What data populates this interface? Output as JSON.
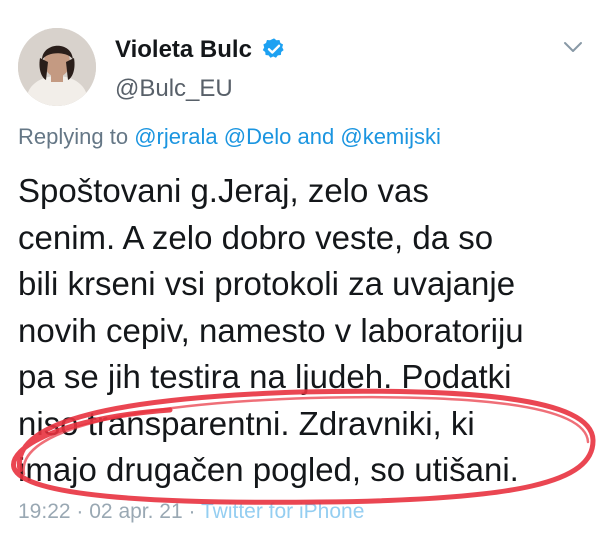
{
  "author": {
    "display_name": "Violeta Bulc",
    "handle": "@Bulc_EU",
    "verified": true,
    "avatar_icon": "profile-photo"
  },
  "reply": {
    "prefix": "Replying to",
    "mentions": [
      "@rjerala",
      "@Delo",
      "@kemijski"
    ],
    "joiner": "and"
  },
  "tweet_lines": [
    "Spoštovani g.Jeraj, zelo vas",
    "cenim. A zelo dobro veste, da so",
    "bili krseni vsi protokoli za uvajanje",
    "novih cepiv, namesto v laboratoriju",
    "pa se jih testira na ljudeh. Podatki",
    "niso transparentni. Zdravniki, ki",
    "imajo drugačen  pogled, so utišani."
  ],
  "meta": {
    "time": "19:22",
    "separator": "·",
    "date": "02 apr. 21",
    "source": "Twitter for iPhone"
  },
  "colors": {
    "link": "#1b95e0",
    "secondary": "#657786",
    "highlight_circle": "#e8323f"
  },
  "icons": {
    "verified": "verified-badge-icon",
    "more": "chevron-down-icon"
  }
}
